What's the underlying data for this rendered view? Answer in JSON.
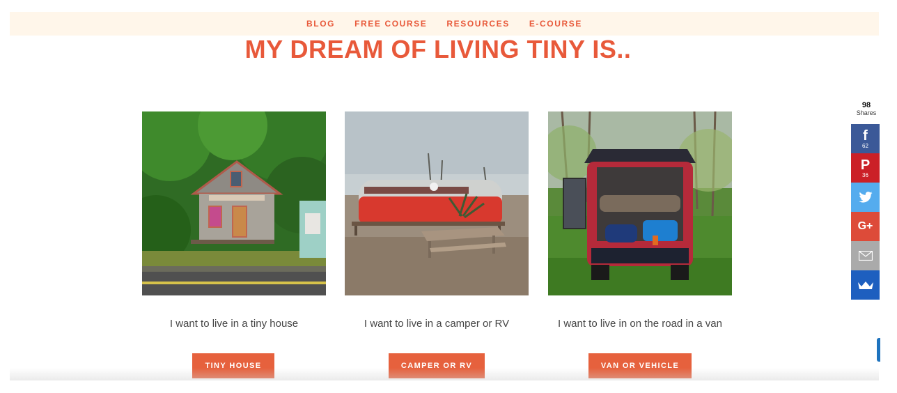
{
  "nav": {
    "items": [
      "BLOG",
      "FREE COURSE",
      "RESOURCES",
      "E-COURSE"
    ]
  },
  "headline": "MY DREAM OF LIVING TINY IS..",
  "cards": [
    {
      "caption": "I want to live in a tiny house",
      "button": "TINY HOUSE"
    },
    {
      "caption": "I want to live in a camper or RV",
      "button": "CAMPER OR RV"
    },
    {
      "caption": "I want to live in on the road in a van",
      "button": "VAN OR VEHICLE"
    }
  ],
  "share": {
    "total": "98",
    "label": "Shares",
    "buttons": [
      {
        "icon": "facebook-icon",
        "glyph": "f",
        "count": "62",
        "color": "#3b5998"
      },
      {
        "icon": "pinterest-icon",
        "glyph": "P",
        "count": "36",
        "color": "#cb2027"
      },
      {
        "icon": "twitter-icon",
        "glyph": "",
        "count": "",
        "color": "#55acee"
      },
      {
        "icon": "google-plus-icon",
        "glyph": "G+",
        "count": "",
        "color": "#dd4b39"
      },
      {
        "icon": "email-icon",
        "glyph": "",
        "count": "",
        "color": "#aaaaaa"
      },
      {
        "icon": "sumo-crown-icon",
        "glyph": "",
        "count": "",
        "color": "#1e5fbf"
      }
    ]
  },
  "colors": {
    "accent": "#e8593a",
    "nav_bg": "#fff6ea",
    "button": "#e6613d"
  }
}
